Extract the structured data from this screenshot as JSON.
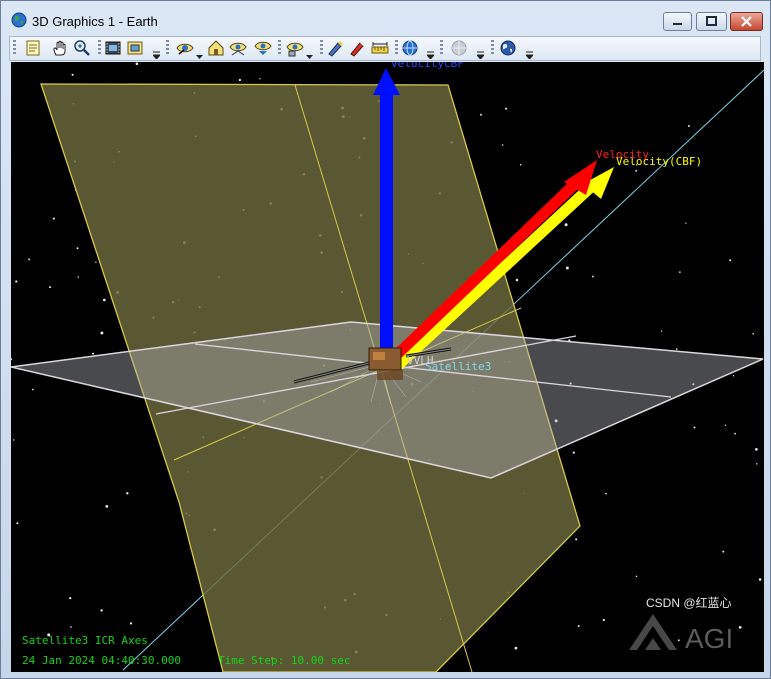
{
  "window": {
    "title": "3D Graphics 1 - Earth",
    "icon": "globe-icon",
    "controls": [
      "minimize-icon",
      "maximize-icon",
      "close-icon"
    ]
  },
  "toolbar": {
    "groups": [
      [
        "properties-icon",
        "pan-hand-icon",
        "zoom-icon"
      ],
      [
        "film-icon",
        "snapshot-icon"
      ],
      [
        "view-from-to-icon",
        "home-view-icon",
        "orbit-view-icon",
        "vertical-view-icon"
      ],
      [
        "view-from-object-icon"
      ],
      [
        "measure-pen-icon",
        "marker-pen-icon",
        "ruler-icon"
      ],
      [
        "globe-view-icon"
      ],
      [
        "disabled-globe-icon"
      ],
      [
        "earth-globe-icon"
      ]
    ]
  },
  "scene": {
    "labels": {
      "velocity_cbf": "Velocity(CBF)",
      "velocity": "Velocity",
      "body_axes": "VelocityCBF",
      "satellite": "Satellite3",
      "body_vector": "VVLH"
    },
    "colors": {
      "space": "#000000",
      "z_vector": "#0010ff",
      "velocity": "#ff0000",
      "velocity_cbf": "#ffff00",
      "plane_yellow": "#7a7040",
      "plane_white": "#ffffff",
      "orbit_line": "#7fd8f0",
      "hud_text": "#19d219"
    }
  },
  "hud": {
    "axes_label": "Satellite3 ICR Axes",
    "datetime": "24 Jan 2024 04:40:30.000",
    "timestep": "Time Step: 10.00 sec"
  },
  "branding": {
    "agi_logo": "AGI",
    "watermark": "CSDN @红蓝心"
  }
}
